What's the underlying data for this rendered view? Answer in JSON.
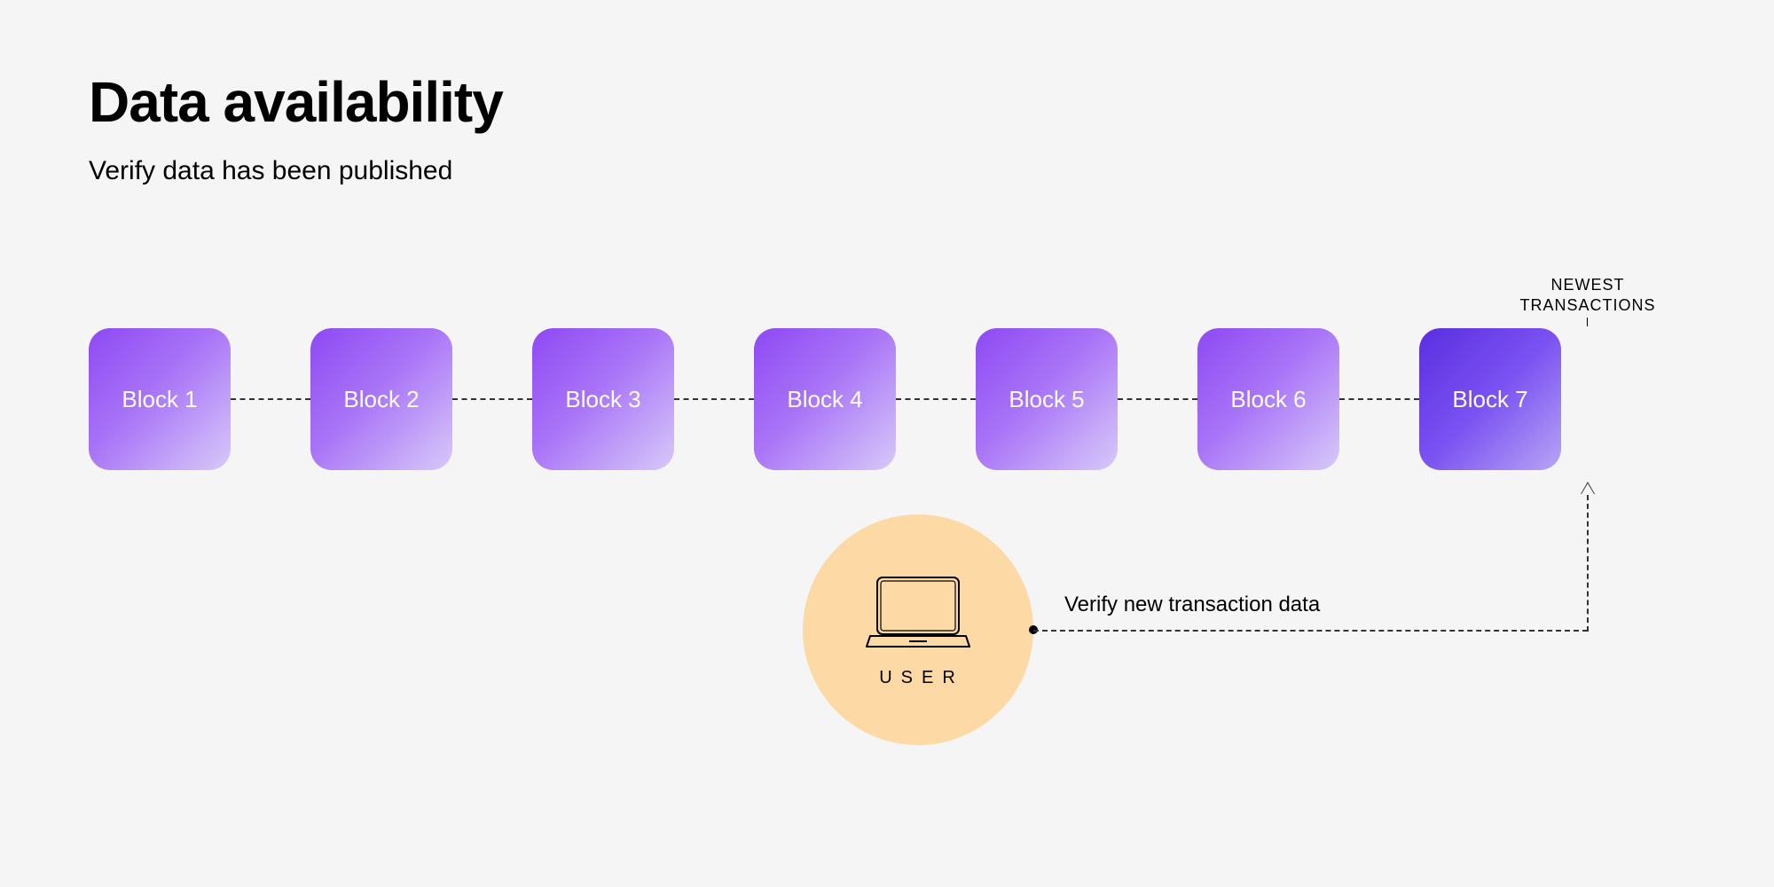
{
  "title": "Data availability",
  "subtitle": "Verify data has been published",
  "blocks": [
    "Block 1",
    "Block 2",
    "Block 3",
    "Block 4",
    "Block 5",
    "Block 6",
    "Block 7"
  ],
  "newest_label_line1": "NEWEST",
  "newest_label_line2": "TRANSACTIONS",
  "user_label": "USER",
  "verify_label": "Verify new transaction data",
  "colors": {
    "background": "#f5f5f5",
    "block_gradient_start": "#8d49f3",
    "block_gradient_end": "#d7caf9",
    "newest_gradient_start": "#5a2ee0",
    "user_circle": "#fcd9a5"
  }
}
